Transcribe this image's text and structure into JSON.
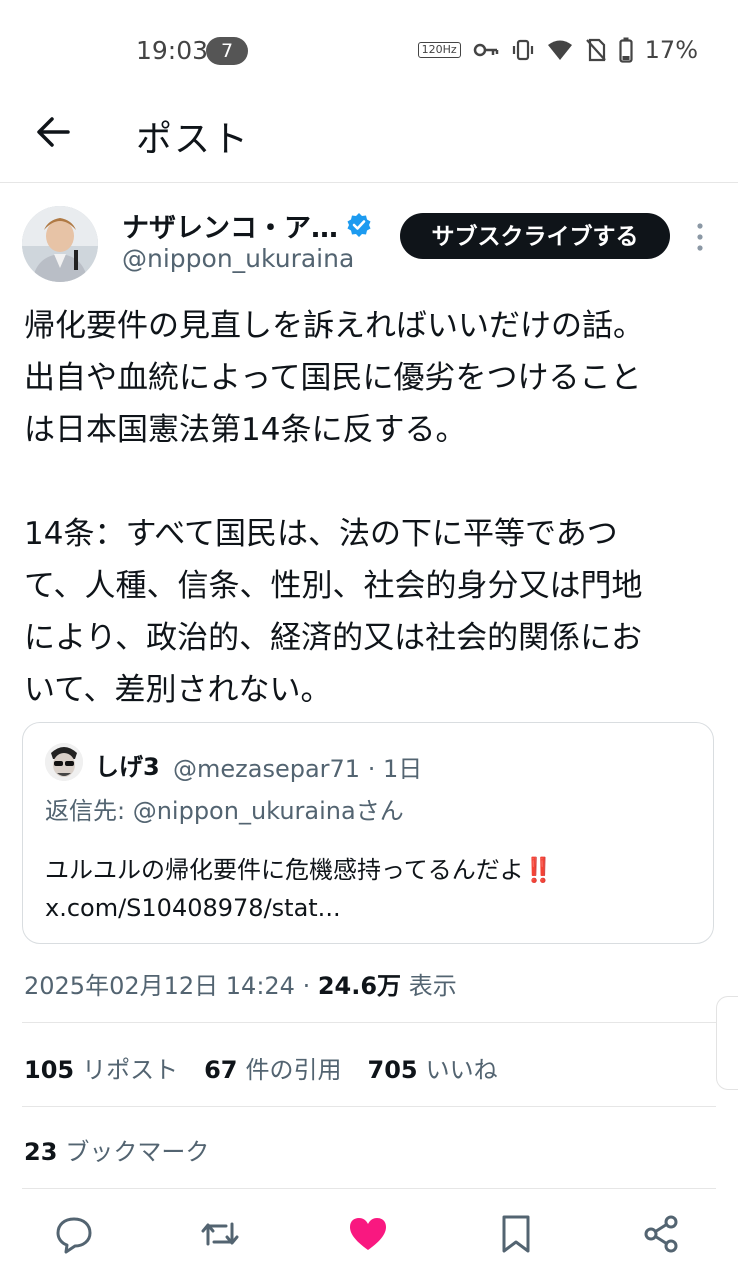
{
  "status_bar": {
    "time": "19:03",
    "notification_count": "7",
    "refresh_rate": "120Hz",
    "battery": "17%"
  },
  "header": {
    "title": "ポスト"
  },
  "author": {
    "name": "ナザレンコ・ア…",
    "handle": "@nippon_ukuraina",
    "subscribe_label": "サブスクライブする"
  },
  "tweet": {
    "text": "帰化要件の見直しを訴えればいいだけの話。\n出自や血統によって国民に優劣をつけること\nは日本国憲法第14条に反する。\n\n14条：すべて国民は、法の下に平等であつ\nて、人種、信条、性別、社会的身分又は門地\nにより、政治的、経済的又は社会的関係にお\nいて、差別されない。"
  },
  "quote": {
    "name": "しげ3",
    "handle_time": "@mezasepar71 · 1日",
    "reply_to": "返信先: @nippon_ukurainaさん",
    "text": "ユルユルの帰化要件に危機感持ってるんだよ‼️\nx.com/S10408978/stat..."
  },
  "meta": {
    "datetime": "2025年02月12日 14:24 · ",
    "views_count": "24.6万",
    "views_label": " 表示"
  },
  "stats": {
    "reposts_count": "105",
    "reposts_label": "リポスト",
    "quotes_count": "67",
    "quotes_label": "件の引用",
    "likes_count": "705",
    "likes_label": "いいね",
    "bookmarks_count": "23",
    "bookmarks_label": "ブックマーク"
  },
  "actions": [
    "reply-icon",
    "repost-icon",
    "like-icon",
    "bookmark-icon",
    "share-icon"
  ],
  "colors": {
    "like": "#f91880",
    "verified": "#1d9bf0",
    "secondary_text": "#536471"
  }
}
